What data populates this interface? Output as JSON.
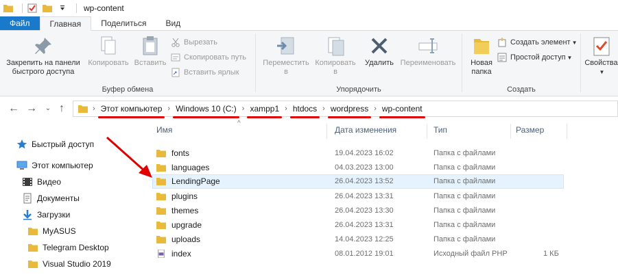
{
  "titlebar": {
    "title": "wp-content"
  },
  "tabs": [
    "Файл",
    "Главная",
    "Поделиться",
    "Вид"
  ],
  "ribbon": {
    "clipboard": {
      "pin_label_1": "Закрепить на панели",
      "pin_label_2": "быстрого доступа",
      "copy_label": "Копировать",
      "paste_label": "Вставить",
      "cut_label": "Вырезать",
      "copy_path_label": "Скопировать путь",
      "paste_shortcut_label": "Вставить ярлык",
      "group_label": "Буфер обмена"
    },
    "organize": {
      "move_label_1": "Переместить",
      "move_label_2": "в",
      "copy_to_label_1": "Копировать",
      "copy_to_label_2": "в",
      "delete_label": "Удалить",
      "rename_label": "Переименовать",
      "group_label": "Упорядочить"
    },
    "create": {
      "new_folder_label_1": "Новая",
      "new_folder_label_2": "папка",
      "new_item_label": "Создать элемент",
      "easy_access_label": "Простой доступ",
      "group_label": "Создать"
    },
    "open": {
      "properties_label": "Свойства"
    }
  },
  "address": {
    "breadcrumbs": [
      "Этот компьютер",
      "Windows 10 (C:)",
      "xampp1",
      "htdocs",
      "wordpress",
      "wp-content"
    ]
  },
  "navpane": {
    "items": [
      {
        "label": "Быстрый доступ",
        "icon": "star-icon"
      },
      {
        "label": "Этот компьютер",
        "icon": "computer-icon"
      },
      {
        "label": "Видео",
        "icon": "video-icon"
      },
      {
        "label": "Документы",
        "icon": "documents-icon"
      },
      {
        "label": "Загрузки",
        "icon": "downloads-icon"
      },
      {
        "label": "MyASUS",
        "icon": "folder-icon"
      },
      {
        "label": "Telegram Desktop",
        "icon": "folder-icon"
      },
      {
        "label": "Visual Studio 2019",
        "icon": "folder-icon"
      }
    ]
  },
  "filelist": {
    "columns": [
      "Имя",
      "Дата изменения",
      "Тип",
      "Размер"
    ],
    "rows": [
      {
        "name": "fonts",
        "date": "19.04.2023 16:02",
        "type": "Папка с файлами",
        "size": ""
      },
      {
        "name": "languages",
        "date": "04.03.2023 13:00",
        "type": "Папка с файлами",
        "size": ""
      },
      {
        "name": "LendingPage",
        "date": "26.04.2023 13:52",
        "type": "Папка с файлами",
        "size": ""
      },
      {
        "name": "plugins",
        "date": "26.04.2023 13:31",
        "type": "Папка с файлами",
        "size": ""
      },
      {
        "name": "themes",
        "date": "26.04.2023 13:30",
        "type": "Папка с файлами",
        "size": ""
      },
      {
        "name": "upgrade",
        "date": "26.04.2023 13:31",
        "type": "Папка с файлами",
        "size": ""
      },
      {
        "name": "uploads",
        "date": "14.04.2023 12:25",
        "type": "Папка с файлами",
        "size": ""
      },
      {
        "name": "index",
        "date": "08.01.2012 19:01",
        "type": "Исходный файл PHP",
        "size": "1 КБ"
      }
    ],
    "selected_index": 2
  },
  "colors": {
    "accent": "#1979ca",
    "folder": "#e8b93a",
    "annotation": "#e00000",
    "selected_row": "#e5f3ff"
  }
}
